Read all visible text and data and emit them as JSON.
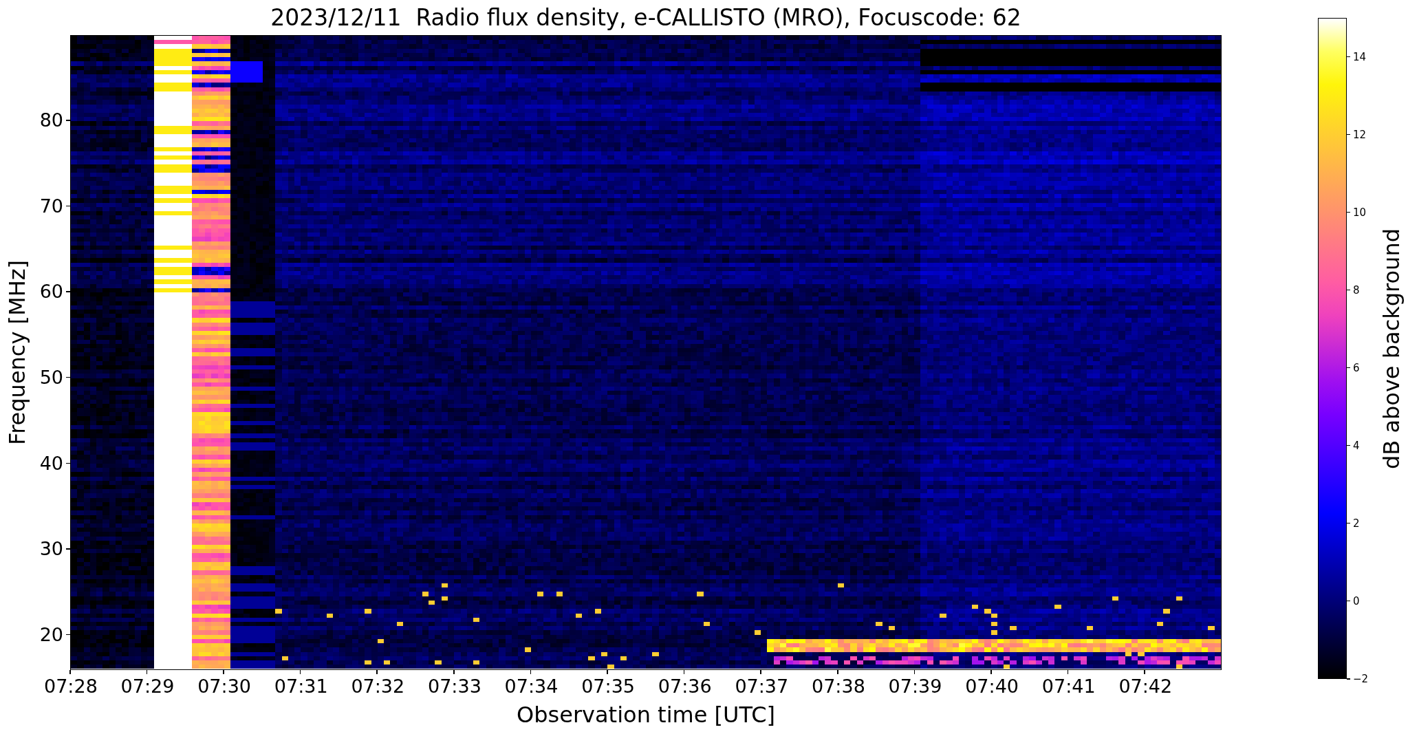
{
  "title": "2023/12/11  Radio flux density, e-CALLISTO (MRO), Focuscode: 62",
  "plot": {
    "xlabel": "Observation time [UTC]",
    "ylabel": "Frequency [MHz]",
    "xticks": [
      "07:28",
      "07:29",
      "07:30",
      "07:31",
      "07:32",
      "07:33",
      "07:34",
      "07:35",
      "07:36",
      "07:37",
      "07:38",
      "07:39",
      "07:40",
      "07:41",
      "07:42"
    ],
    "yticks": [
      "80",
      "70",
      "60",
      "50",
      "40",
      "30",
      "20"
    ]
  },
  "colorbar": {
    "label": "dB above background",
    "ticks": [
      "14",
      "12",
      "10",
      "8",
      "6",
      "4",
      "2",
      "0",
      "−2"
    ]
  }
}
